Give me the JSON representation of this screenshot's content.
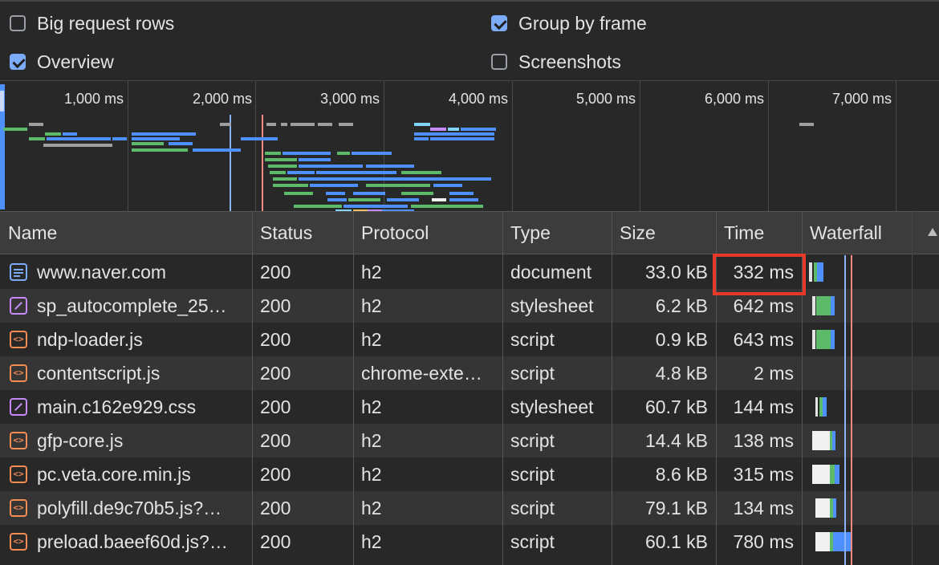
{
  "settings": {
    "big_request_rows": {
      "label": "Big request rows",
      "checked": false
    },
    "group_by_frame": {
      "label": "Group by frame",
      "checked": true
    },
    "overview": {
      "label": "Overview",
      "checked": true
    },
    "screenshots": {
      "label": "Screenshots",
      "checked": false
    }
  },
  "overview_ticks": [
    "1,000 ms",
    "2,000 ms",
    "3,000 ms",
    "4,000 ms",
    "5,000 ms",
    "6,000 ms",
    "7,000 ms"
  ],
  "columns": {
    "name": "Name",
    "status": "Status",
    "protocol": "Protocol",
    "type": "Type",
    "size": "Size",
    "time": "Time",
    "waterfall": "Waterfall"
  },
  "rows": [
    {
      "icon": "document-icon",
      "name": "www.naver.com",
      "status": "200",
      "protocol": "h2",
      "type": "document",
      "size": "33.0 kB",
      "time": "332 ms"
    },
    {
      "icon": "stylesheet-icon",
      "name": "sp_autocomplete_25…",
      "status": "200",
      "protocol": "h2",
      "type": "stylesheet",
      "size": "6.2 kB",
      "time": "642 ms"
    },
    {
      "icon": "script-icon",
      "name": "ndp-loader.js",
      "status": "200",
      "protocol": "h2",
      "type": "script",
      "size": "0.9 kB",
      "time": "643 ms"
    },
    {
      "icon": "script-icon",
      "name": "contentscript.js",
      "status": "200",
      "protocol": "chrome-exte…",
      "type": "script",
      "size": "4.8 kB",
      "time": "2 ms"
    },
    {
      "icon": "stylesheet-icon",
      "name": "main.c162e929.css",
      "status": "200",
      "protocol": "h2",
      "type": "stylesheet",
      "size": "60.7 kB",
      "time": "144 ms"
    },
    {
      "icon": "script-icon",
      "name": "gfp-core.js",
      "status": "200",
      "protocol": "h2",
      "type": "script",
      "size": "14.4 kB",
      "time": "138 ms"
    },
    {
      "icon": "script-icon",
      "name": "pc.veta.core.min.js",
      "status": "200",
      "protocol": "h2",
      "type": "script",
      "size": "8.6 kB",
      "time": "315 ms"
    },
    {
      "icon": "script-icon",
      "name": "polyfill.de9c70b5.js?…",
      "status": "200",
      "protocol": "h2",
      "type": "script",
      "size": "79.1 kB",
      "time": "134 ms"
    },
    {
      "icon": "script-icon",
      "name": "preload.baeef60d.js?…",
      "status": "200",
      "protocol": "h2",
      "type": "script",
      "size": "60.1 kB",
      "time": "780 ms"
    }
  ],
  "colors": {
    "accent": "#7cacf8",
    "waiting": "#5cba6a",
    "download": "#4d90fe",
    "highlight": "#e8382a",
    "dom_content_loaded": "#8ab4f8",
    "load": "#f28b82"
  }
}
